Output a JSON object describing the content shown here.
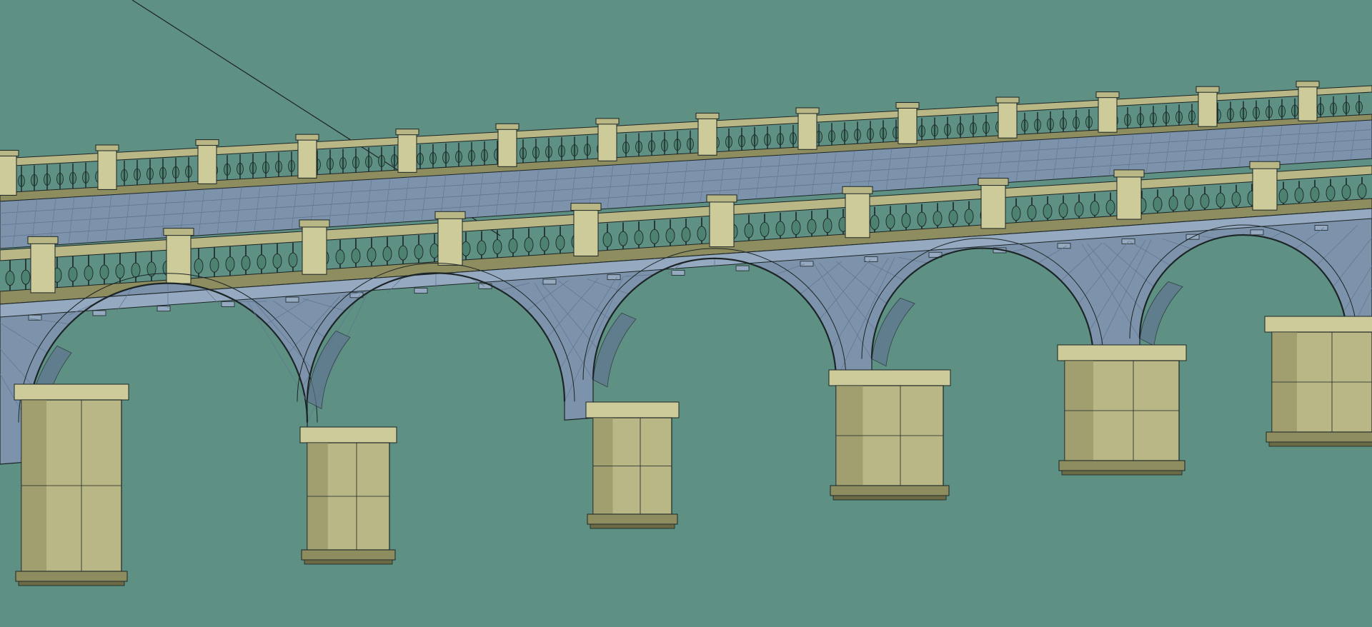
{
  "scene": {
    "subject": "stone-arch-bridge-wireframe",
    "arch_count": 5,
    "pier_count": 6,
    "baluster_railings": 2,
    "colors": {
      "background": "#5f9084",
      "deck": "#7d93ab",
      "deck_dark": "#5f7590",
      "deck_light": "#95a9c0",
      "stone": "#b8b785",
      "stone_dark": "#8e8d5f",
      "stone_light": "#cccb99",
      "baluster": "#4e8270",
      "wire": "#1c2526"
    }
  }
}
